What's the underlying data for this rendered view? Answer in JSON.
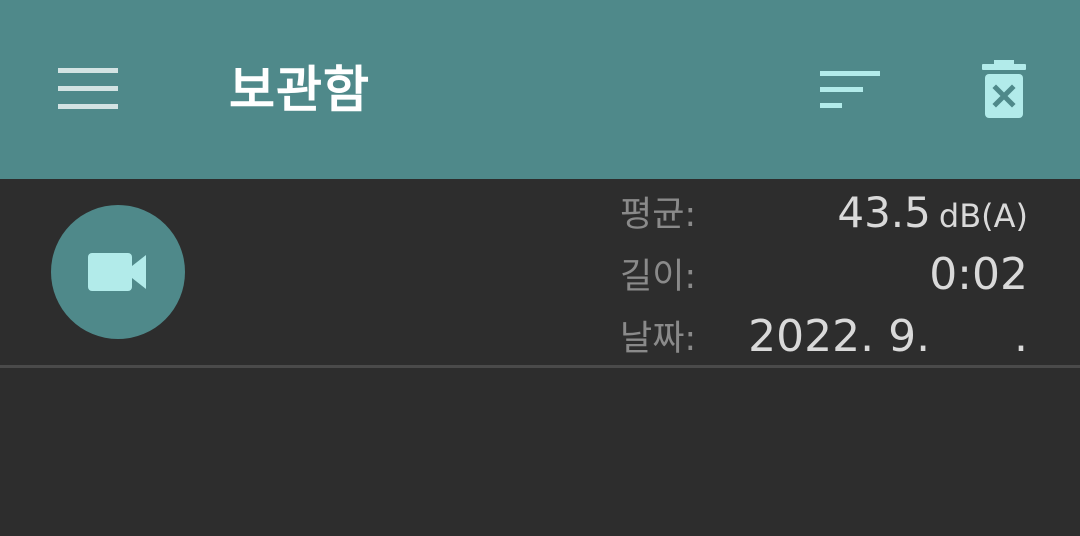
{
  "toolbar": {
    "title": "보관함",
    "background_color": "#4f898a",
    "menu_icon": "menu-icon",
    "sort_icon": "sort-icon",
    "delete_icon": "delete-all-icon",
    "icon_color": "#b2ebea"
  },
  "records": [
    {
      "type_icon": "videocam-icon",
      "average_label": "평균:",
      "average_value": "43.5",
      "average_unit": "dB(A)",
      "length_label": "길이:",
      "length_value": "0:02",
      "date_label": "날짜:",
      "date_value": "2022. 9.      ."
    }
  ]
}
